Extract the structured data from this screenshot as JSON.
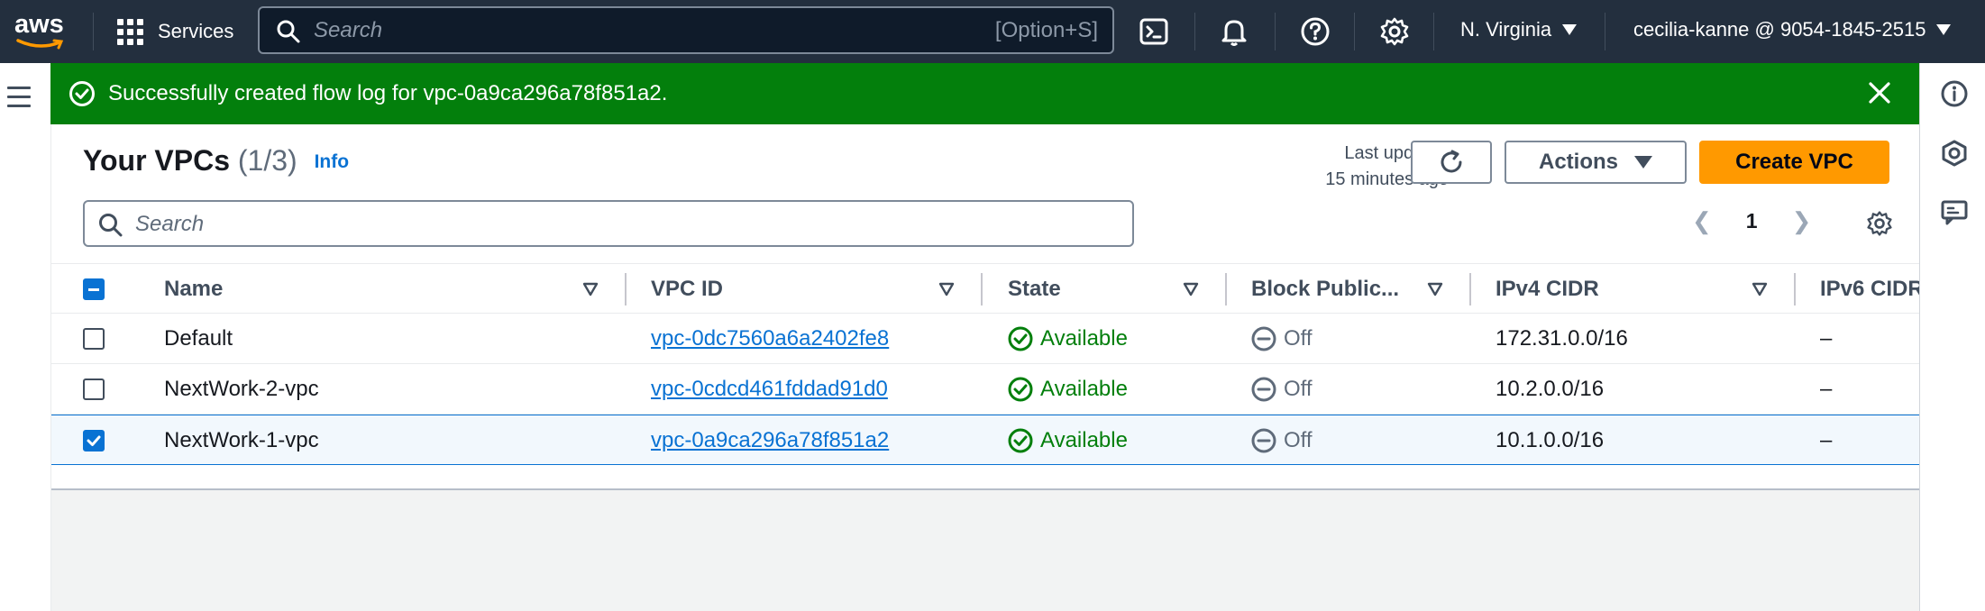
{
  "topnav": {
    "logo_text": "aws",
    "services_label": "Services",
    "search_placeholder": "Search",
    "search_shortcut": "[Option+S]",
    "region": "N. Virginia",
    "account": "cecilia-kanne @ 9054-1845-2515",
    "icons": [
      "cloudshell-icon",
      "bell-icon",
      "help-icon",
      "gear-icon"
    ]
  },
  "flash": {
    "message": "Successfully created flow log for vpc-0a9ca296a78f851a2.",
    "type": "success",
    "color": "#037f0c"
  },
  "panel": {
    "title": "Your VPCs",
    "count": "(1/3)",
    "info": "Info",
    "last_updated_line1": "Last updated",
    "last_updated_line2": "15 minutes ago",
    "actions_label": "Actions",
    "create_label": "Create VPC",
    "search_placeholder": "Search",
    "page": "1",
    "accent": "#ff9900"
  },
  "table": {
    "columns": [
      "Name",
      "VPC ID",
      "State",
      "Block Public...",
      "IPv4 CIDR",
      "IPv6 CIDR"
    ],
    "rows": [
      {
        "selected": false,
        "name": "Default",
        "vpc_id": "vpc-0dc7560a6a2402fe8",
        "state": "Available",
        "block": "Off",
        "ipv4": "172.31.0.0/16",
        "ipv6": "–"
      },
      {
        "selected": false,
        "name": "NextWork-2-vpc",
        "vpc_id": "vpc-0cdcd461fddad91d0",
        "state": "Available",
        "block": "Off",
        "ipv4": "10.2.0.0/16",
        "ipv6": "–"
      },
      {
        "selected": true,
        "name": "NextWork-1-vpc",
        "vpc_id": "vpc-0a9ca296a78f851a2",
        "state": "Available",
        "block": "Off",
        "ipv4": "10.1.0.0/16",
        "ipv6": "–"
      }
    ]
  }
}
